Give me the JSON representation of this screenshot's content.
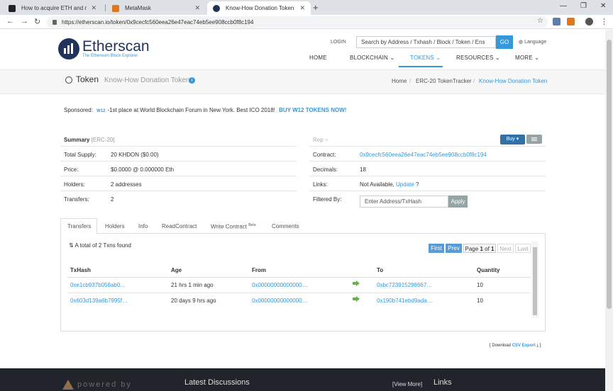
{
  "browser": {
    "tabs": [
      {
        "title": "How to acquire ETH and make a",
        "active": false
      },
      {
        "title": "MetaMask",
        "active": false
      },
      {
        "title": "Know-How Donation Token (KHD",
        "active": true
      }
    ],
    "url": "https://etherscan.io/token/0x9cecfc560eea26e47eac74eb5ee908ccb0f8c194"
  },
  "header": {
    "logo_name": "Etherscan",
    "logo_tagline": "The Ethereum Block Explorer",
    "login": "LOGIN",
    "search_placeholder": "Search by Address / Txhash / Block / Token / Ens",
    "search_button": "GO",
    "language": "Language",
    "nav": [
      "HOME",
      "BLOCKCHAIN",
      "TOKENS",
      "RESOURCES",
      "MORE"
    ],
    "active_nav": "TOKENS"
  },
  "title_band": {
    "token_label": "Token",
    "token_name": "Know-How Donation Token",
    "breadcrumb": [
      "Home",
      "ERC-20 TokenTracker",
      "Know-How Donation Token"
    ]
  },
  "sponsored": {
    "label": "Sponsored:",
    "badge": "W12",
    "text": "-1st place at World Blockchain Forum in New York. Best ICO 2018!",
    "cta": "BUY W12 TOKENS NOW!"
  },
  "summary": {
    "title": "Summary",
    "standard": "[ERC-20]",
    "rep": "Rep",
    "buy_label": "Buy",
    "left_rows": [
      {
        "label": "Total Supply:",
        "value": "20 KHDON ($0.00)"
      },
      {
        "label": "Price:",
        "value": "$0.0000 @ 0.000000 Eth"
      },
      {
        "label": "Holders:",
        "value": "2 addresses"
      },
      {
        "label": "Transfers:",
        "value": "2"
      }
    ],
    "contract_label": "Contract:",
    "contract_value": "0x9cecfc560eea26e47eac74eb5ee908ccb0f8c194",
    "decimals_label": "Decimals:",
    "decimals_value": "18",
    "links_label": "Links:",
    "links_value": "Not Available,",
    "links_update": "Update",
    "links_q": "?",
    "filter_label": "Filtered By:",
    "filter_placeholder": "Enter Address/TxHash",
    "apply_label": "Apply"
  },
  "page_tabs": [
    "Transfers",
    "Holders",
    "Info",
    "ReadContract",
    "Write Contract",
    "Comments"
  ],
  "page_tab_beta": "Beta",
  "transfers": {
    "total": "A total of 2 Txns found",
    "pagination": {
      "first": "First",
      "prev": "Prev",
      "page_text": "Page",
      "page_num": "1",
      "of_text": "of",
      "of_num": "1",
      "next": "Next",
      "last": "Last"
    },
    "columns": [
      "TxHash",
      "Age",
      "From",
      "To",
      "Quantity"
    ],
    "rows": [
      {
        "txhash": "0xe1cb937b058ab0…",
        "age": "21 hrs 1 min ago",
        "from": "0x00000000000000…",
        "to": "0xbc723915298667…",
        "qty": "10"
      },
      {
        "txhash": "0x603d139a6b7995f…",
        "age": "20 days 9 hrs ago",
        "from": "0x00000000000000…",
        "to": "0x190b741ebd9ada…",
        "qty": "10"
      }
    ]
  },
  "download": {
    "prefix": "[ Download",
    "link": "CSV Export",
    "suffix": "]"
  },
  "footer": {
    "powered_by": "powered by",
    "latest_discussions": "Latest Discussions",
    "view_more": "[View More]",
    "links": "Links"
  },
  "colors": {
    "accent": "#3498db",
    "brand_navy": "#21325b",
    "footer_bg": "#21242a"
  }
}
